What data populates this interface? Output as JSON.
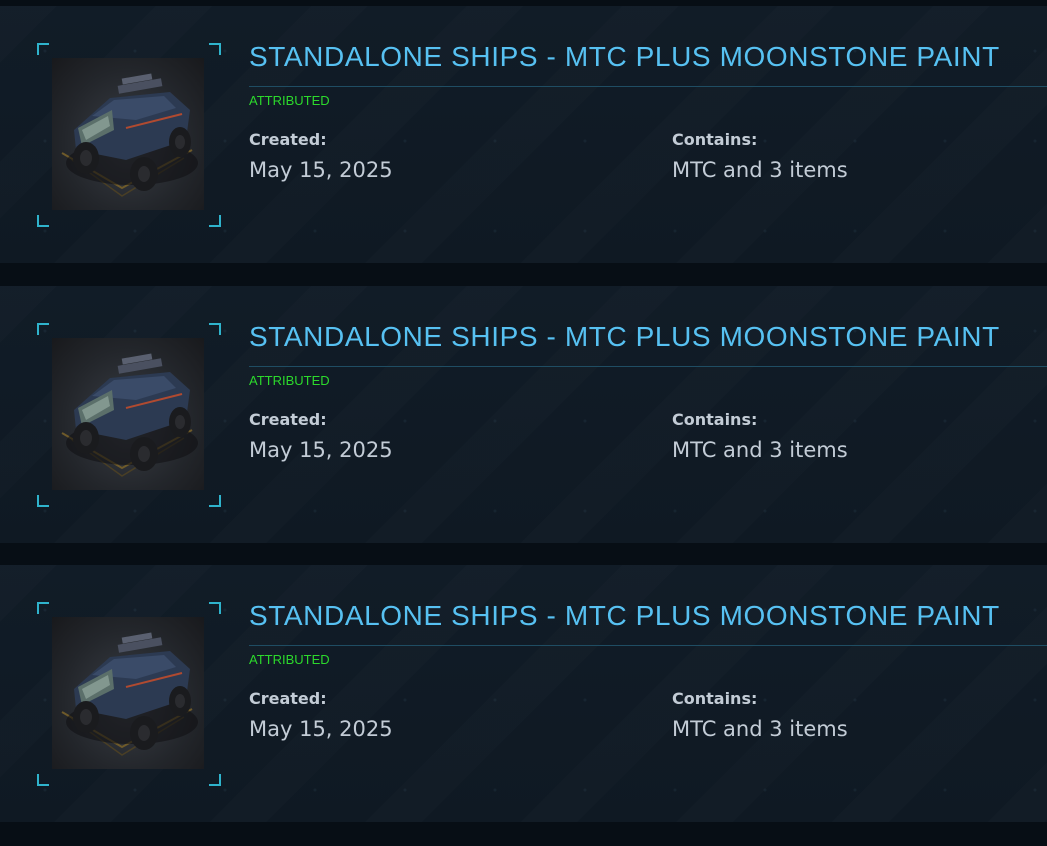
{
  "pledges": [
    {
      "title": "STANDALONE SHIPS - MTC PLUS MOONSTONE PAINT",
      "status": "ATTRIBUTED",
      "created_label": "Created:",
      "created_value": "May 15, 2025",
      "contains_label": "Contains:",
      "contains_value": "MTC and 3 items"
    },
    {
      "title": "STANDALONE SHIPS - MTC PLUS MOONSTONE PAINT",
      "status": "ATTRIBUTED",
      "created_label": "Created:",
      "created_value": "May 15, 2025",
      "contains_label": "Contains:",
      "contains_value": "MTC and 3 items"
    },
    {
      "title": "STANDALONE SHIPS - MTC PLUS MOONSTONE PAINT",
      "status": "ATTRIBUTED",
      "created_label": "Created:",
      "created_value": "May 15, 2025",
      "contains_label": "Contains:",
      "contains_value": "MTC and 3 items"
    }
  ],
  "colors": {
    "title": "#57c1f2",
    "status": "#2cd92c",
    "text": "#c3ccd6",
    "frame_accent": "#2fb3cc",
    "card_bg": "#111c27",
    "page_bg": "#070e15"
  }
}
